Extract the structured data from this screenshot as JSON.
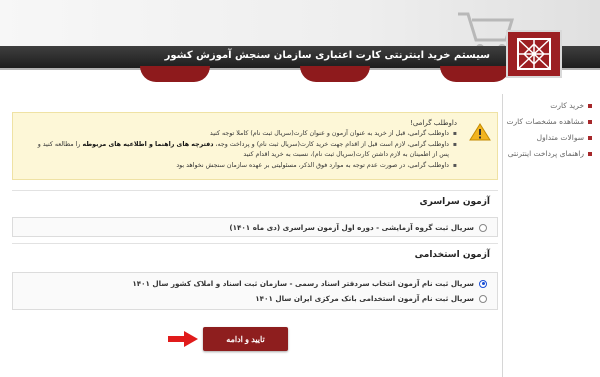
{
  "header": {
    "title": "سیستم خرید اینترنتی کارت اعتباری سازمان سنجش آموزش کشور"
  },
  "sidebar": {
    "items": [
      {
        "label": "خرید کارت"
      },
      {
        "label": "مشاهده مشخصات کارت"
      },
      {
        "label": "سوالات متداول"
      },
      {
        "label": "راهنمای پرداخت اینترنتی"
      }
    ]
  },
  "notice": {
    "heading": "داوطلب گرامی!",
    "line1": "داوطلب گرامی، قبل از خرید به عنوان آزمون و عنوان کارت(سریال ثبت نام) کاملا توجه کنید",
    "line2a": "داوطلب گرامی، لازم است قبل از اقدام جهت خرید کارت(سریال ثبت نام) و پرداخت وجه، ",
    "line2b": "دفترچه های راهنما و اطلاعیه های مربوطه",
    "line2c": " را مطالعه کنید و پس از اطمینان به لازم داشتن کارت(سریال ثبت نام)، نسبت به خرید اقدام کنید",
    "line3": "داوطلب گرامی، در صورت عدم توجه به موارد فوق الذکر، مسئولیتی بر عهده سازمان سنجش نخواهد بود"
  },
  "sections": {
    "national": {
      "title": "آزمون سراسری",
      "options": [
        {
          "label": "سریال ثبت گروه آزمایشی - دوره اول آزمون سراسری (دی ماه ۱۴۰۱)",
          "selected": false
        }
      ]
    },
    "employment": {
      "title": "آزمون استخدامی",
      "options": [
        {
          "label": "سریال ثبت نام آزمون انتخاب سردفتر اسناد رسمی - سازمان ثبت اسناد و املاک کشور سال ۱۴۰۱",
          "selected": true
        },
        {
          "label": "سریال ثبت نام آزمون استخدامی بانک مرکزی ایران سال ۱۴۰۱",
          "selected": false
        }
      ]
    }
  },
  "actions": {
    "submit_label": "تایید و ادامه"
  },
  "colors": {
    "brand": "#8e1e1e",
    "notice_bg": "#fdf7d7",
    "radio_selected": "#1a4fd6"
  },
  "icons": [
    "shopping-cart-icon",
    "logo-emblem",
    "warning-icon",
    "red-arrow-icon"
  ]
}
